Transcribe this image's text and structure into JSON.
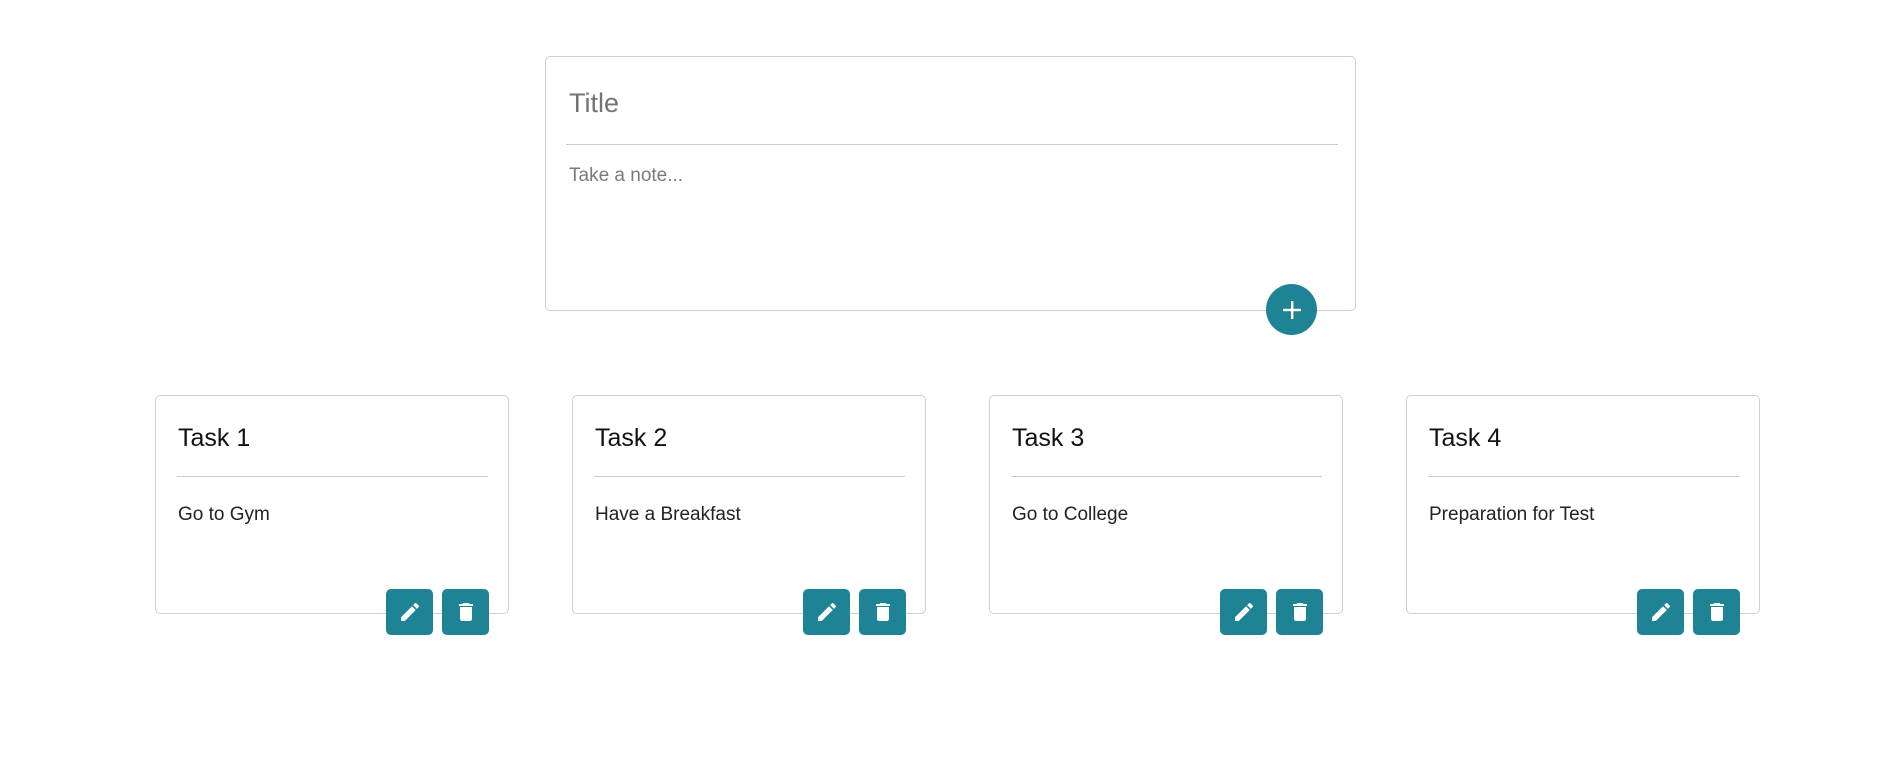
{
  "composer": {
    "title_placeholder": "Title",
    "note_placeholder": "Take a note...",
    "add_icon": "plus-icon"
  },
  "notes": [
    {
      "title": "Task 1",
      "content": "Go to Gym"
    },
    {
      "title": "Task 2",
      "content": "Have a Breakfast"
    },
    {
      "title": "Task 3",
      "content": "Go to College"
    },
    {
      "title": "Task 4",
      "content": "Preparation for Test"
    }
  ],
  "card_icons": {
    "edit": "pencil-icon",
    "delete": "trash-icon"
  },
  "colors": {
    "accent": "#1e8394",
    "border": "#cfcfcf",
    "divider": "#cccccc",
    "placeholder": "#747474"
  }
}
